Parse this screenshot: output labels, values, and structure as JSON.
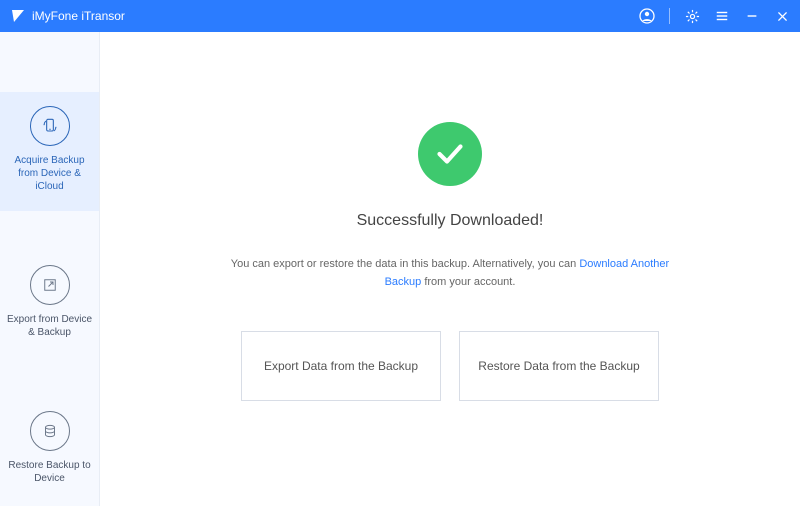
{
  "titlebar": {
    "app_name": "iMyFone iTransor"
  },
  "sidebar": {
    "items": [
      {
        "label": "Acquire Backup from Device & iCloud",
        "active": true
      },
      {
        "label": "Export from Device & Backup",
        "active": false
      },
      {
        "label": "Restore Backup to Device",
        "active": false
      }
    ]
  },
  "main": {
    "heading": "Successfully Downloaded!",
    "desc_prefix": "You can export or restore the data in this backup. Alternatively, you can ",
    "desc_link": "Download Another Backup",
    "desc_suffix": " from your account.",
    "actions": {
      "export_label": "Export Data from the Backup",
      "restore_label": "Restore Data from the Backup"
    }
  },
  "colors": {
    "primary": "#2b7cff",
    "success": "#3ec96e"
  }
}
